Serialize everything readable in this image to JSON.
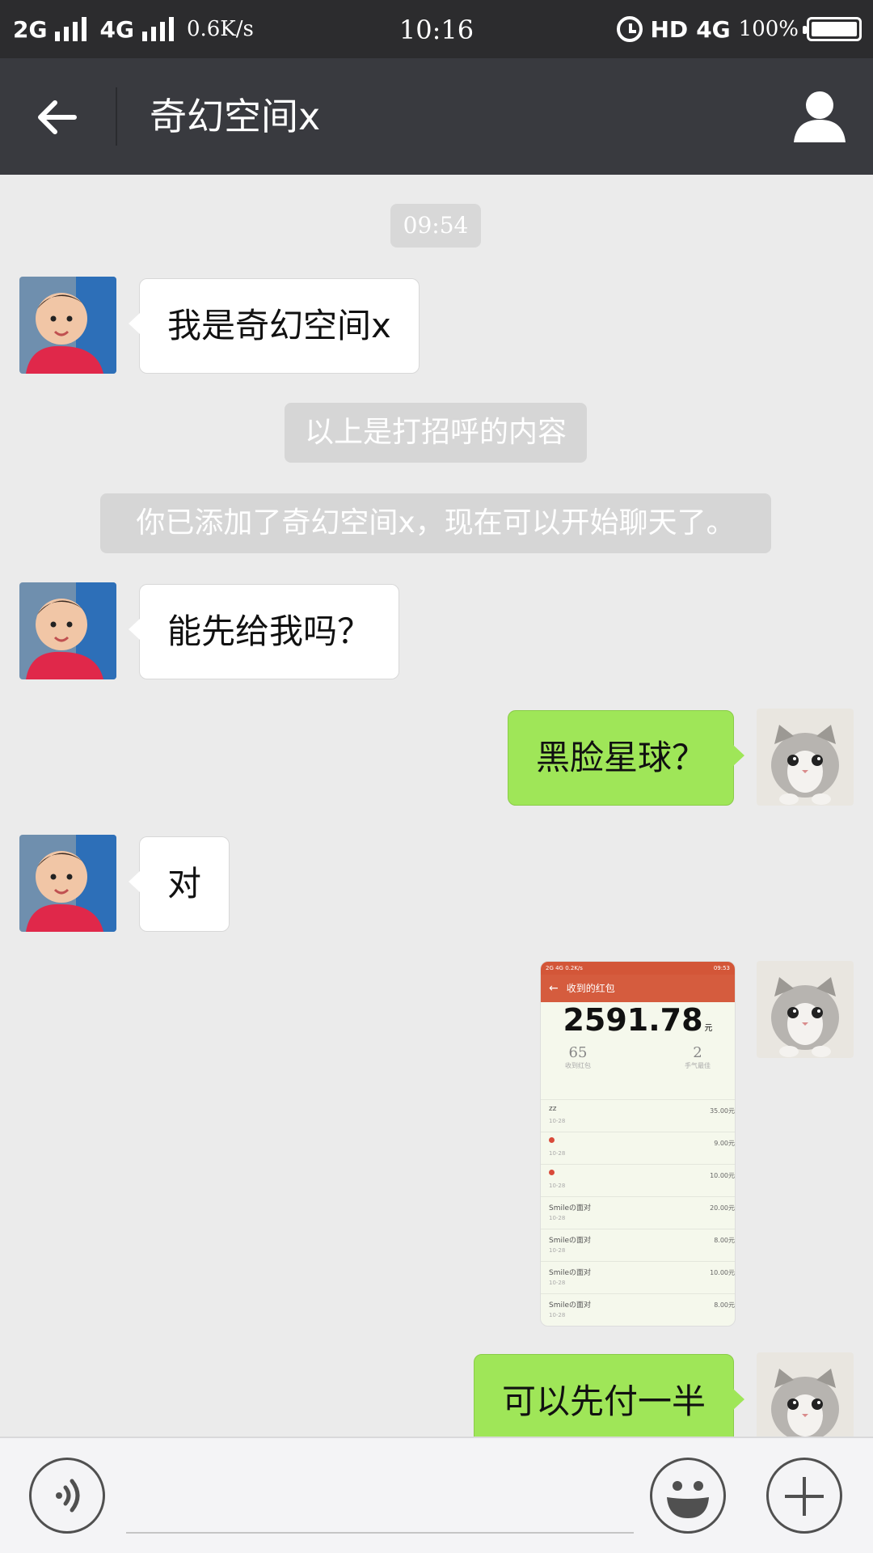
{
  "status_bar": {
    "network1": "2G",
    "network2": "4G",
    "speed": "0.6K/s",
    "time": "10:16",
    "hd": "HD",
    "lte": "4G",
    "battery": "100%"
  },
  "header": {
    "title": "奇幻空间x",
    "back_icon": "arrow-left-icon",
    "profile_icon": "person-icon"
  },
  "chat": {
    "timestamp": "09:54",
    "system_greeting": "以上是打招呼的内容",
    "system_added": "你已添加了奇幻空间x，现在可以开始聊天了。",
    "messages": [
      {
        "side": "in",
        "text": "我是奇幻空间x"
      },
      {
        "side": "in",
        "text": "能先给我吗？"
      },
      {
        "side": "out",
        "text": "黑脸星球？"
      },
      {
        "side": "in",
        "text": "对"
      },
      {
        "side": "out",
        "text": "可以先付一半"
      }
    ],
    "image_message": {
      "status_left": "2G 4G 0.2K/s",
      "status_time": "09:53",
      "title": "收到的红包",
      "total": "2591.78",
      "unit": "元",
      "received_count": "65",
      "received_label": "收到红包",
      "best_luck_count": "2",
      "best_luck_label": "手气最佳",
      "rows": [
        {
          "name": "zz",
          "date": "10-28",
          "amount": "35.00元",
          "pin": false
        },
        {
          "name": "",
          "date": "10-28",
          "amount": "9.00元",
          "pin": true
        },
        {
          "name": "",
          "date": "10-28",
          "amount": "10.00元",
          "pin": true
        },
        {
          "name": "Smileの面对",
          "date": "10-28",
          "amount": "20.00元",
          "pin": false
        },
        {
          "name": "Smileの面对",
          "date": "10-28",
          "amount": "8.00元",
          "pin": false
        },
        {
          "name": "Smileの面对",
          "date": "10-28",
          "amount": "10.00元",
          "pin": false
        },
        {
          "name": "Smileの面对",
          "date": "10-28",
          "amount": "8.00元",
          "pin": false
        }
      ]
    }
  },
  "input_bar": {
    "voice_icon": "voice-icon",
    "emoji_icon": "emoji-icon",
    "plus_icon": "plus-icon",
    "input_value": ""
  },
  "colors": {
    "status_bar": "#2c2c2e",
    "nav_bar": "#393a3f",
    "chat_bg": "#ebebeb",
    "out_bubble": "#9fe658",
    "in_bubble": "#ffffff",
    "red_packet_header": "#d55c3e"
  }
}
